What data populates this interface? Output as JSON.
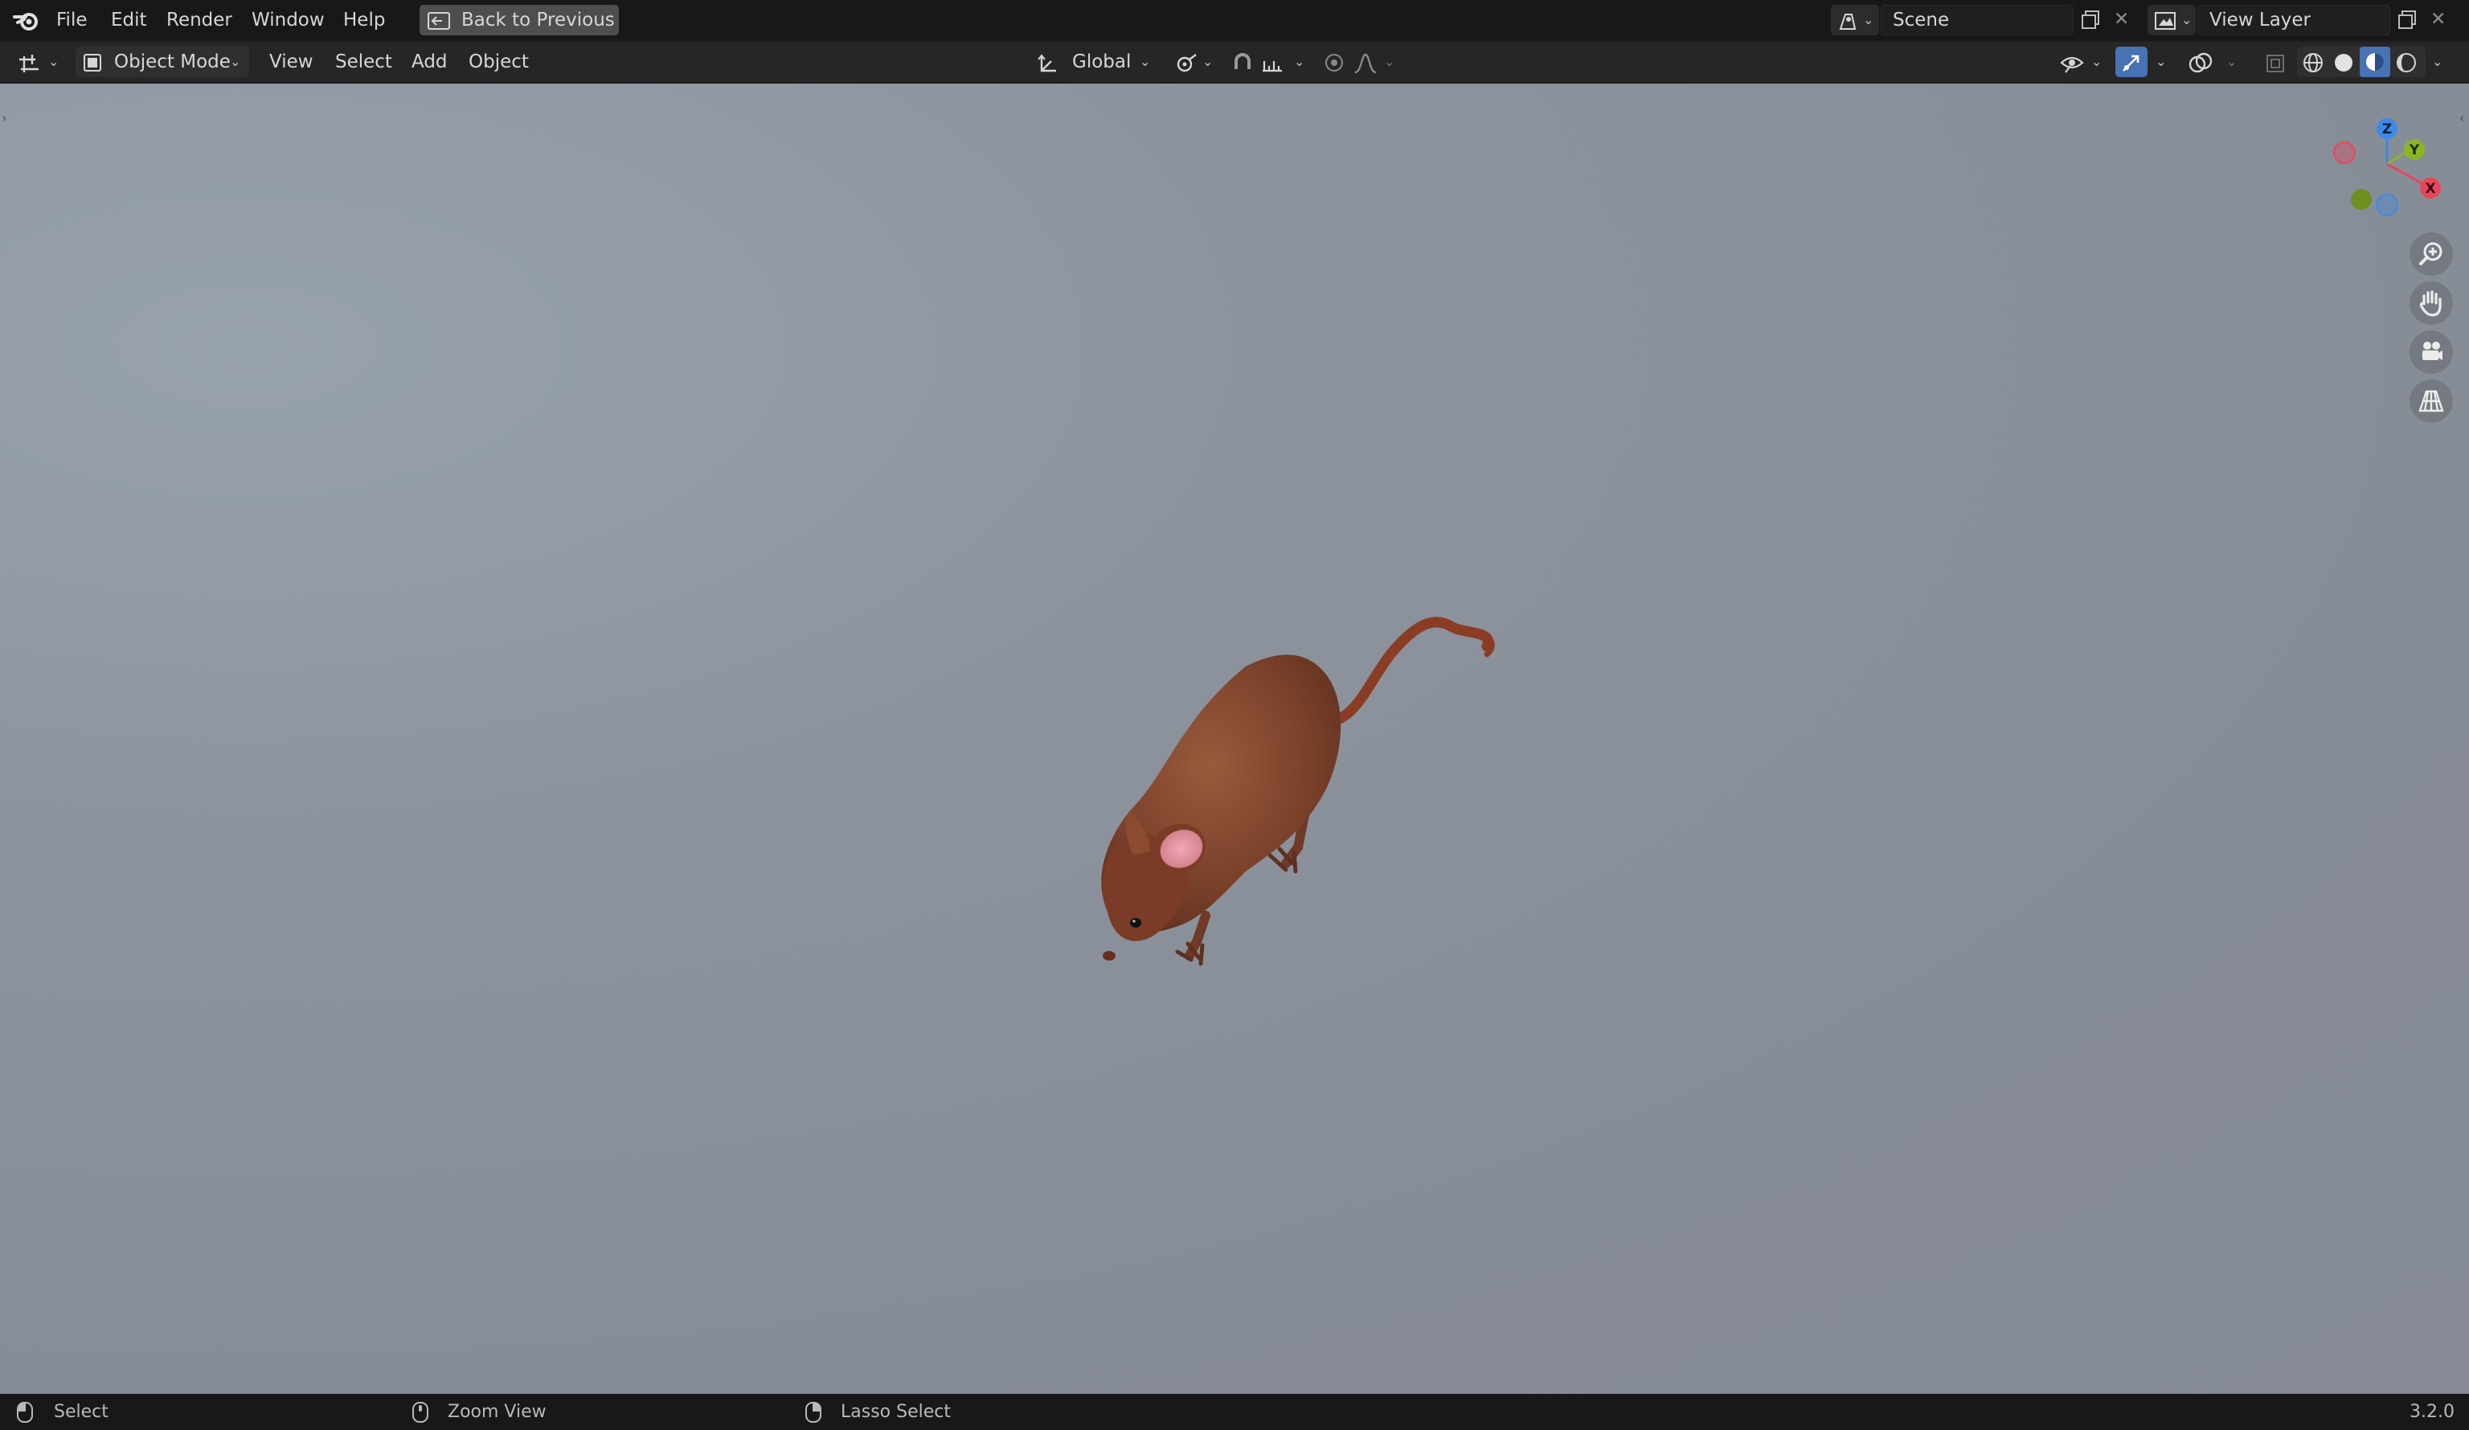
{
  "topbar": {
    "menus": [
      "File",
      "Edit",
      "Render",
      "Window",
      "Help"
    ],
    "back_button": "Back to Previous",
    "scene": {
      "label": "Scene"
    },
    "view_layer": {
      "label": "View Layer"
    }
  },
  "header": {
    "mode": "Object Mode",
    "menus": [
      "View",
      "Select",
      "Add",
      "Object"
    ],
    "transform_orientation": "Global"
  },
  "gizmo": {
    "x": "X",
    "y": "Y",
    "z": "Z"
  },
  "status": {
    "select": "Select",
    "zoom": "Zoom View",
    "lasso": "Lasso Select",
    "version": "3.2.0"
  },
  "colors": {
    "accent": "#4772b3",
    "axis_x": "#e8465a",
    "axis_y": "#8ab526",
    "axis_z": "#3d89e6"
  },
  "icons": [
    "blender-logo-icon",
    "back-icon",
    "scene-icon",
    "copy-icon",
    "close-icon",
    "view-layer-icon",
    "editor-type-icon",
    "object-mode-icon",
    "transform-orientation-icon",
    "pivot-icon",
    "snap-icon",
    "snap-increment-icon",
    "proportional-edit-icon",
    "falloff-icon",
    "visibility-icon",
    "gizmo-icon",
    "overlay-icon",
    "xray-icon",
    "wireframe-shading-icon",
    "solid-shading-icon",
    "material-shading-icon",
    "rendered-shading-icon",
    "zoom-icon",
    "pan-hand-icon",
    "camera-icon",
    "grid-icon",
    "mouse-left-icon",
    "mouse-middle-icon"
  ]
}
